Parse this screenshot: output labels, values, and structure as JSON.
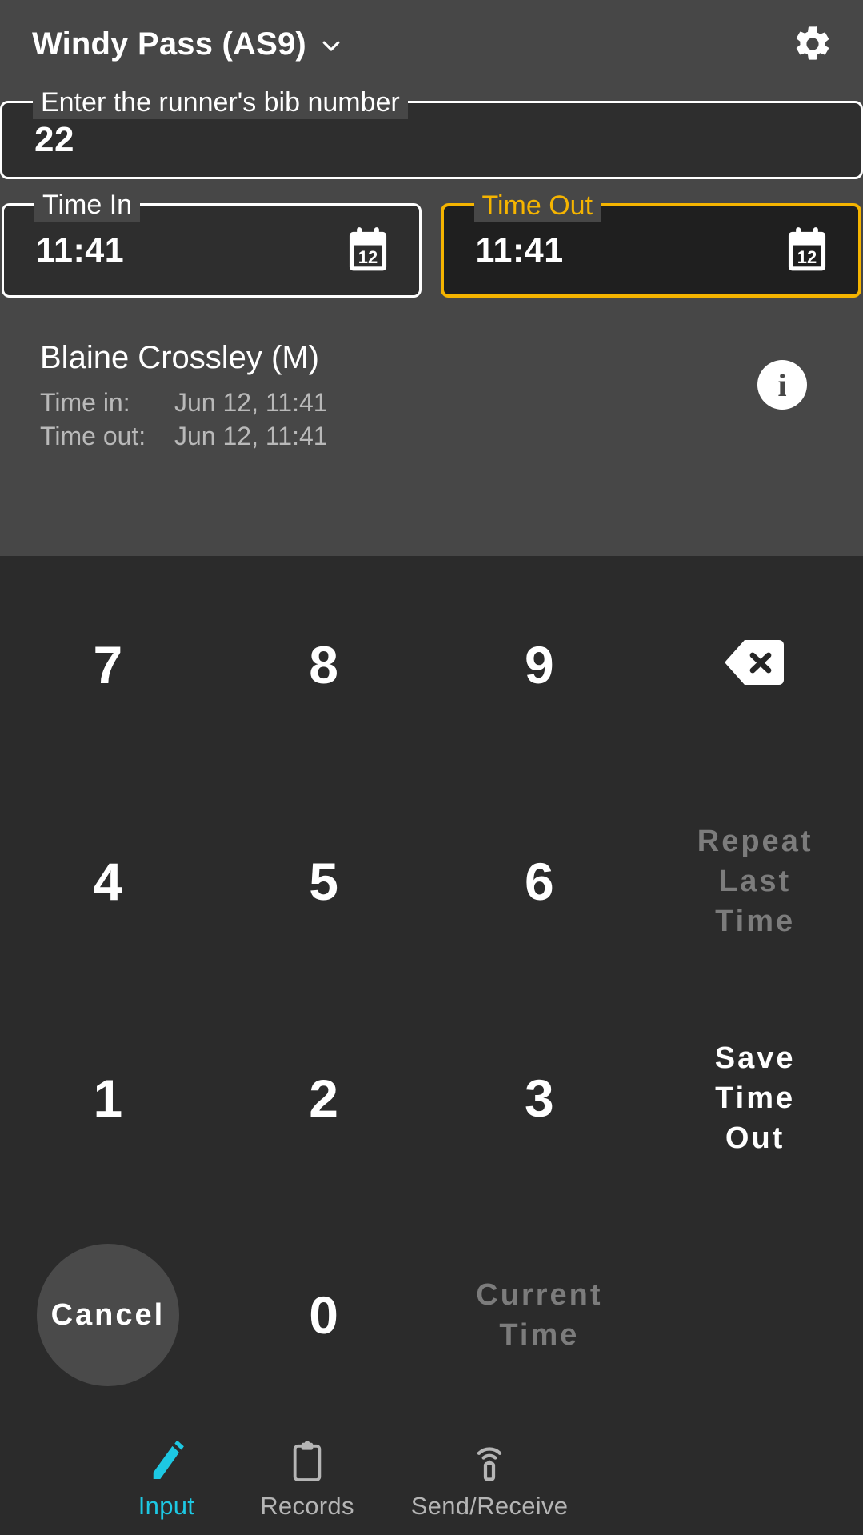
{
  "theme": {
    "panel_bg": "#474747",
    "keypad_bg": "#2b2b2b",
    "accent_amber": "#f5b400",
    "accent_cyan": "#1dc8e3",
    "text_primary": "#ffffff",
    "text_muted": "#b9b9b9",
    "text_disabled": "#7c7c7c"
  },
  "appbar": {
    "title": "Windy Pass (AS9)",
    "dropdown_icon": "chevron-down-icon",
    "settings_icon": "gear-icon"
  },
  "bib_field": {
    "legend": "Enter the runner's bib number",
    "value": "22",
    "placeholder": "Enter the runner's bib number"
  },
  "time_in_field": {
    "legend": "Time In",
    "value": "11:41",
    "icon": "calendar-icon",
    "icon_day": "12",
    "focused": false
  },
  "time_out_field": {
    "legend": "Time Out",
    "value": "11:41",
    "icon": "calendar-icon",
    "icon_day": "12",
    "focused": true
  },
  "record": {
    "name": "Blaine Crossley (M)",
    "time_in_label": "Time in:",
    "time_in_value": "Jun 12, 11:41",
    "time_out_label": "Time out:",
    "time_out_value": "Jun 12, 11:41",
    "info_icon": "info-icon",
    "info_glyph": "i"
  },
  "keypad": {
    "keys": [
      {
        "id": "key-7",
        "label": "7",
        "type": "digit",
        "state": "enabled"
      },
      {
        "id": "key-8",
        "label": "8",
        "type": "digit",
        "state": "enabled"
      },
      {
        "id": "key-9",
        "label": "9",
        "type": "digit",
        "state": "enabled"
      },
      {
        "id": "key-backspace",
        "label": "",
        "type": "icon",
        "icon": "backspace-icon",
        "state": "enabled"
      },
      {
        "id": "key-4",
        "label": "4",
        "type": "digit",
        "state": "enabled"
      },
      {
        "id": "key-5",
        "label": "5",
        "type": "digit",
        "state": "enabled"
      },
      {
        "id": "key-6",
        "label": "6",
        "type": "digit",
        "state": "enabled"
      },
      {
        "id": "key-repeat-last-time",
        "label": "Repeat Last Time",
        "type": "word",
        "state": "disabled"
      },
      {
        "id": "key-1",
        "label": "1",
        "type": "digit",
        "state": "enabled"
      },
      {
        "id": "key-2",
        "label": "2",
        "type": "digit",
        "state": "enabled"
      },
      {
        "id": "key-3",
        "label": "3",
        "type": "digit",
        "state": "enabled"
      },
      {
        "id": "key-save-time-out",
        "label": "Save Time Out",
        "type": "word",
        "state": "enabled"
      },
      {
        "id": "key-cancel",
        "label": "Cancel",
        "type": "word",
        "state": "pressed"
      },
      {
        "id": "key-0",
        "label": "0",
        "type": "digit",
        "state": "enabled"
      },
      {
        "id": "key-current-time",
        "label": "Current Time",
        "type": "word",
        "state": "disabled"
      },
      {
        "id": "key-blank",
        "label": "",
        "type": "blank",
        "state": "enabled"
      }
    ],
    "labels": {
      "k7": "7",
      "k8": "8",
      "k9": "9",
      "k4": "4",
      "k5": "5",
      "k6": "6",
      "k1": "1",
      "k2": "2",
      "k3": "3",
      "k0": "0",
      "repeat_last_time": "Repeat\nLast\nTime",
      "repeat_last_time_lines": [
        "Repeat",
        "Last",
        "Time"
      ],
      "save_time_out_lines": [
        "Save",
        "Time",
        "Out"
      ],
      "current_time_lines": [
        "Current",
        "Time"
      ],
      "cancel": "Cancel"
    }
  },
  "bottom_nav": {
    "items": [
      {
        "label": "Input",
        "icon": "pencil-icon",
        "active": true
      },
      {
        "label": "Records",
        "icon": "clipboard-icon",
        "active": false
      },
      {
        "label": "Send/Receive",
        "icon": "antenna-signal-icon",
        "active": false
      }
    ]
  }
}
